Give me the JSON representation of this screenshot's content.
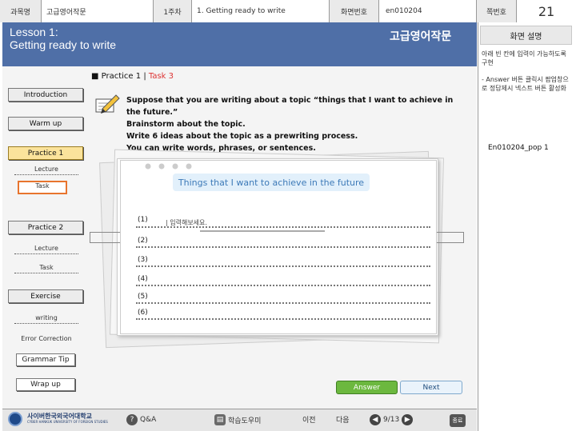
{
  "meta": {
    "course_label": "과목명",
    "course_value": "고급영어작문",
    "week_label": "1주차",
    "week_value": "1. Getting ready to write",
    "screen_label": "화면번호",
    "screen_value": "en010204",
    "page_label": "쪽번호",
    "page_value": "21"
  },
  "header": {
    "lesson_line1": "Lesson 1:",
    "lesson_line2": "Getting ready to write",
    "course_title": "고급영어작문"
  },
  "side_panel": {
    "title": "화면 설명",
    "note1": "아래 빈 칸에 입력이 가능하도록 구현",
    "note2": "- Answer 버튼 클릭시 팝업창으로 정답제시 넥스트 버튼 활성화",
    "popup_code": "En010204_pop 1"
  },
  "sidebar": {
    "introduction": "Introduction",
    "warm_up": "Warm up",
    "practice1": "Practice 1",
    "p1_lecture": "Lecture",
    "p1_task": "Task",
    "practice2": "Practice 2",
    "p2_lecture": "Lecture",
    "p2_task": "Task",
    "exercise": "Exercise",
    "ex_writing": "writing",
    "ex_error": "Error Correction",
    "grammar_tip": "Grammar Tip",
    "wrap_up": "Wrap up"
  },
  "content": {
    "practice_label": "Practice 1",
    "separator": "|",
    "task_label": "Task 3",
    "instruction_lines": [
      "Suppose that you are writing about a topic “things that I want to achieve in the future.”",
      "Brainstorm about the topic.",
      "Write 6 ideas about the topic as a prewriting process.",
      "You can write words, phrases, or sentences."
    ]
  },
  "popup": {
    "title": "Things that I want to achieve in the future",
    "hint": "| 입력해보세요.",
    "items": [
      "(1)",
      "(2)",
      "(3)",
      "(4)",
      "(5)",
      "(6)"
    ]
  },
  "buttons": {
    "answer": "Answer",
    "next": "Next"
  },
  "footer": {
    "university": "사이버한국외국어대학교",
    "university_en": "CYBER HANKUK UNIVERSITY OF FOREIGN STUDIES",
    "qa": "Q&A",
    "study": "학습도우미",
    "prev": "이전",
    "next": "다음",
    "page": "9/13",
    "end": "종료"
  },
  "colors": {
    "header_blue": "#4f6fa7",
    "answer_green": "#6cb83f",
    "active_nav": "#fbe39b",
    "selected_border": "#e8742e",
    "task_red": "#dd3333"
  }
}
